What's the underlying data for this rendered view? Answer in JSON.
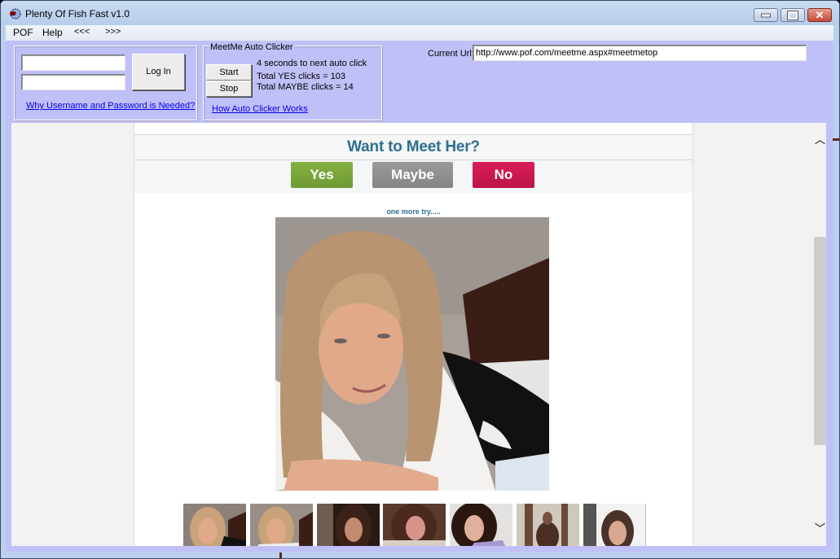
{
  "window": {
    "title": "Plenty Of Fish Fast v1.0",
    "controls": {
      "minimize": "minimize",
      "maximize": "maximize",
      "close": "close"
    }
  },
  "menu": {
    "items": [
      {
        "label": "POF"
      },
      {
        "label": "Help"
      },
      {
        "label": "<<<"
      },
      {
        "label": ">>>"
      }
    ]
  },
  "login": {
    "username_value": "",
    "password_value": "",
    "login_button": "Log In",
    "why_link": "Why Username and Password is Needed?"
  },
  "auto_clicker": {
    "legend": "MeetMe Auto Clicker",
    "start_button": "Start",
    "stop_button": "Stop",
    "countdown_text": "4 seconds to next auto click",
    "yes_clicks_text": "Total YES clicks = 103",
    "maybe_clicks_text": "Total MAYBE clicks = 14",
    "how_link": "How Auto Clicker Works"
  },
  "url_bar": {
    "label": "Current Url:",
    "value": "http://www.pof.com/meetme.aspx#meetmetop"
  },
  "page": {
    "heading": "Want to Meet Her?",
    "yes_label": "Yes",
    "maybe_label": "Maybe",
    "no_label": "No",
    "colors": {
      "yes": "#78a63a",
      "maybe": "#8e8e8e",
      "no": "#cc1850",
      "heading": "#2e7090"
    },
    "caption": "one more try.....",
    "thumbnails_count": 7
  }
}
